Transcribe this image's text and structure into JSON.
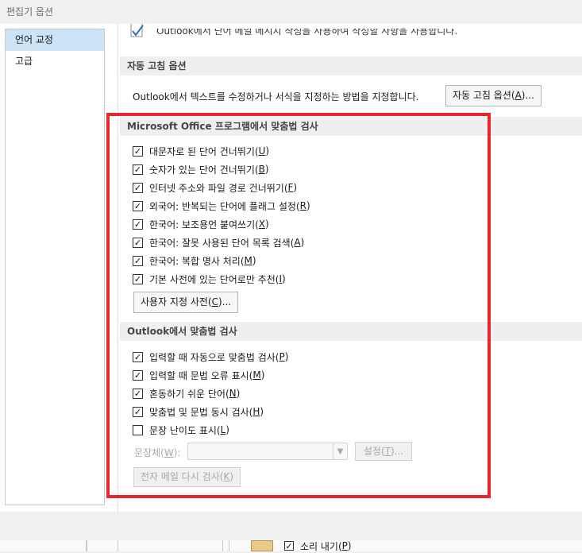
{
  "window": {
    "title": "편집기 옵션"
  },
  "nav": {
    "items": [
      "언어 교정",
      "고급"
    ]
  },
  "top_partial": {
    "text": "Outlook에서 단어 메일 메시지 작성을 사용하여 작성할 사항을 사용합니다."
  },
  "autocorrect": {
    "header": "자동 고침 옵션",
    "description": "Outlook에서 텍스트를 수정하거나 서식을 지정하는 방법을 지정합니다.",
    "button": {
      "text": "자동 고침 옵션(",
      "mnemonic": "A",
      "suffix": ")..."
    }
  },
  "office_spelling": {
    "header": "Microsoft Office 프로그램에서 맞춤법 검사",
    "items": [
      {
        "text": "대문자로 된 단어 건너뛰기(",
        "mnemonic": "U",
        "suffix": ")",
        "mark": "✓"
      },
      {
        "text": "숫자가 있는 단어 건너뛰기(",
        "mnemonic": "B",
        "suffix": ")",
        "mark": "✓"
      },
      {
        "text": "인터넷 주소와 파일 경로 건너뛰기(",
        "mnemonic": "F",
        "suffix": ")",
        "mark": "✓"
      },
      {
        "text": "외국어: 반복되는 단어에 플래그 설정(",
        "mnemonic": "R",
        "suffix": ")",
        "mark": "✓"
      },
      {
        "text": "한국어: 보조용언 붙여쓰기(",
        "mnemonic": "X",
        "suffix": ")",
        "mark": "✓"
      },
      {
        "text": "한국어: 잘못 사용된 단어 목록 검색(",
        "mnemonic": "A",
        "suffix": ")",
        "mark": "✓"
      },
      {
        "text": "한국어: 복합 명사 처리(",
        "mnemonic": "M",
        "suffix": ")",
        "mark": "✓"
      },
      {
        "text": "기본 사전에 있는 단어로만 추천(",
        "mnemonic": "I",
        "suffix": ")",
        "mark": "✓"
      }
    ],
    "custom_dict_button": {
      "text": "사용자 지정 사전(",
      "mnemonic": "C",
      "suffix": ")..."
    }
  },
  "outlook_spelling": {
    "header": "Outlook에서 맞춤법 검사",
    "items": [
      {
        "text": "입력할 때 자동으로 맞춤법 검사(",
        "mnemonic": "P",
        "suffix": ")",
        "mark": "✓"
      },
      {
        "text": "입력할 때 문법 오류 표시(",
        "mnemonic": "M",
        "suffix": ")",
        "mark": "✓"
      },
      {
        "text": "혼동하기 쉬운 단어(",
        "mnemonic": "N",
        "suffix": ")",
        "mark": "✓"
      },
      {
        "text": "맞춤법 및 문법 동시 검사(",
        "mnemonic": "H",
        "suffix": ")",
        "mark": "✓"
      },
      {
        "text": "문장 난이도 표시(",
        "mnemonic": "L",
        "suffix": ")",
        "mark": ""
      }
    ],
    "style_label": {
      "text": "문장체(",
      "mnemonic": "W",
      "suffix": "):"
    },
    "settings_button": {
      "text": "설정(",
      "mnemonic": "T",
      "suffix": ")..."
    },
    "recheck_button": {
      "text": "전자 메일 다시 검사(",
      "mnemonic": "K",
      "suffix": ")"
    }
  },
  "background": {
    "partial_item": {
      "text": "소리 내기(",
      "mnemonic": "P",
      "suffix": ")",
      "mark": "✓"
    }
  },
  "colors": {
    "highlight": "#e8262f",
    "nav_selected": "#cce4f7"
  }
}
